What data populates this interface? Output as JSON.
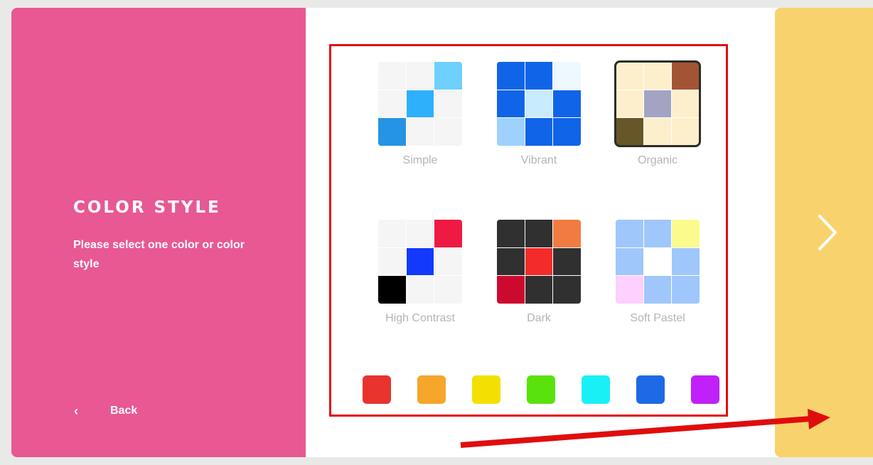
{
  "left": {
    "title": "COLOR STYLE",
    "subtitle": "Please select one color or color style",
    "back_label": "Back"
  },
  "styles": [
    {
      "label": "Simple",
      "selected": false,
      "cells": [
        "#f5f5f5",
        "#f5f5f5",
        "#6fd0fd",
        "#f5f5f5",
        "#2eb0fb",
        "#f5f5f5",
        "#2594e4",
        "#f5f5f5",
        "#f5f5f5"
      ]
    },
    {
      "label": "Vibrant",
      "selected": false,
      "cells": [
        "#1064e8",
        "#1064e8",
        "#eef8ff",
        "#1064e8",
        "#c8ebfd",
        "#1064e8",
        "#9ed1fd",
        "#1064e8",
        "#1064e8"
      ]
    },
    {
      "label": "Organic",
      "selected": true,
      "cells": [
        "#fdefcb",
        "#fdefcb",
        "#a35433",
        "#fdefcb",
        "#a3a4c3",
        "#fdefcb",
        "#675728",
        "#fdefcb",
        "#fdefcb"
      ]
    },
    {
      "label": "High Contrast",
      "selected": false,
      "cells": [
        "#f5f5f5",
        "#f5f5f5",
        "#ef1a43",
        "#f5f5f5",
        "#1339fc",
        "#f5f5f5",
        "#000000",
        "#f5f5f5",
        "#f5f5f5"
      ]
    },
    {
      "label": "Dark",
      "selected": false,
      "cells": [
        "#303030",
        "#303030",
        "#f27b42",
        "#303030",
        "#f42b2b",
        "#303030",
        "#cc0a30",
        "#303030",
        "#303030"
      ]
    },
    {
      "label": "Soft Pastel",
      "selected": false,
      "cells": [
        "#a0c7fb",
        "#a0c7fb",
        "#fbfa8c",
        "#a0c7fb",
        "#ffffff",
        "#a0c7fb",
        "#fdd0fd",
        "#a0c7fb",
        "#a0c7fb"
      ]
    }
  ],
  "swatches": [
    "#e8332e",
    "#f5a62b",
    "#f3e002",
    "#5ae20c",
    "#19f0f6",
    "#1e6ae6",
    "#c020f9"
  ],
  "next_icon": "chevron-right-icon",
  "back_icon": "chevron-left-icon"
}
